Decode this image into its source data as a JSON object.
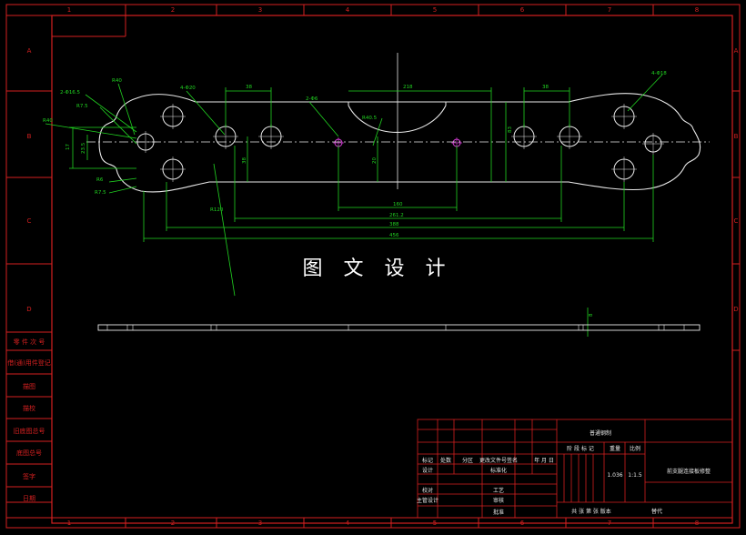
{
  "colors": {
    "frame": "#d42020",
    "part": "#e8e8e8",
    "dimension": "#21d421",
    "marker": "#e040e0",
    "background": "#000000"
  },
  "watermark": "图 文 设 计",
  "grid": {
    "columns": [
      "1",
      "2",
      "3",
      "4",
      "5",
      "6",
      "7",
      "8"
    ],
    "rows": [
      "A",
      "B",
      "C",
      "D"
    ]
  },
  "left_strip": [
    "借(通)用件登记",
    "描图",
    "描校",
    "旧底图总号",
    "底图总号",
    "签字",
    "日期"
  ],
  "left_strip_top": "零 件 次 号",
  "dimensions": {
    "hole_tl": "2-Φ16.5",
    "r_top": "R40",
    "r_left": "R40",
    "r_mid": "R7.5",
    "holes_4": "4-Φ20",
    "pitch_a": "38",
    "center_w": "218",
    "pitch_b": "38",
    "holes_4r": "4-Φ18",
    "holes_2": "2-Φ6",
    "arc_r": "R40.5",
    "h_left": "17",
    "h_left2": "23.5",
    "r_60": "R6",
    "r_75": "R7.5",
    "h_38": "38",
    "h_20": "20",
    "h_83": "83",
    "r_120": "R120",
    "w_160": "160",
    "w_2612": "261.2",
    "w_388": "388",
    "w_456": "456",
    "thick": "8"
  },
  "title_block": {
    "top_cell": "普通钢制",
    "part_name": "前支腿连接板修整",
    "header": [
      "标记",
      "处数",
      "分区",
      "更改文件号签名",
      "年 月 日"
    ],
    "row_labels": [
      "设计",
      "校对",
      "主管设计"
    ],
    "row_labels2": [
      "标准化",
      "工艺",
      "审核",
      "批准"
    ],
    "stage_headers": [
      "阶 段 标 记",
      "重量",
      "比例"
    ],
    "weight": "1.036",
    "scale": "1:1.5",
    "sheet": "共 张 第 张 版本",
    "replace": "替代"
  }
}
